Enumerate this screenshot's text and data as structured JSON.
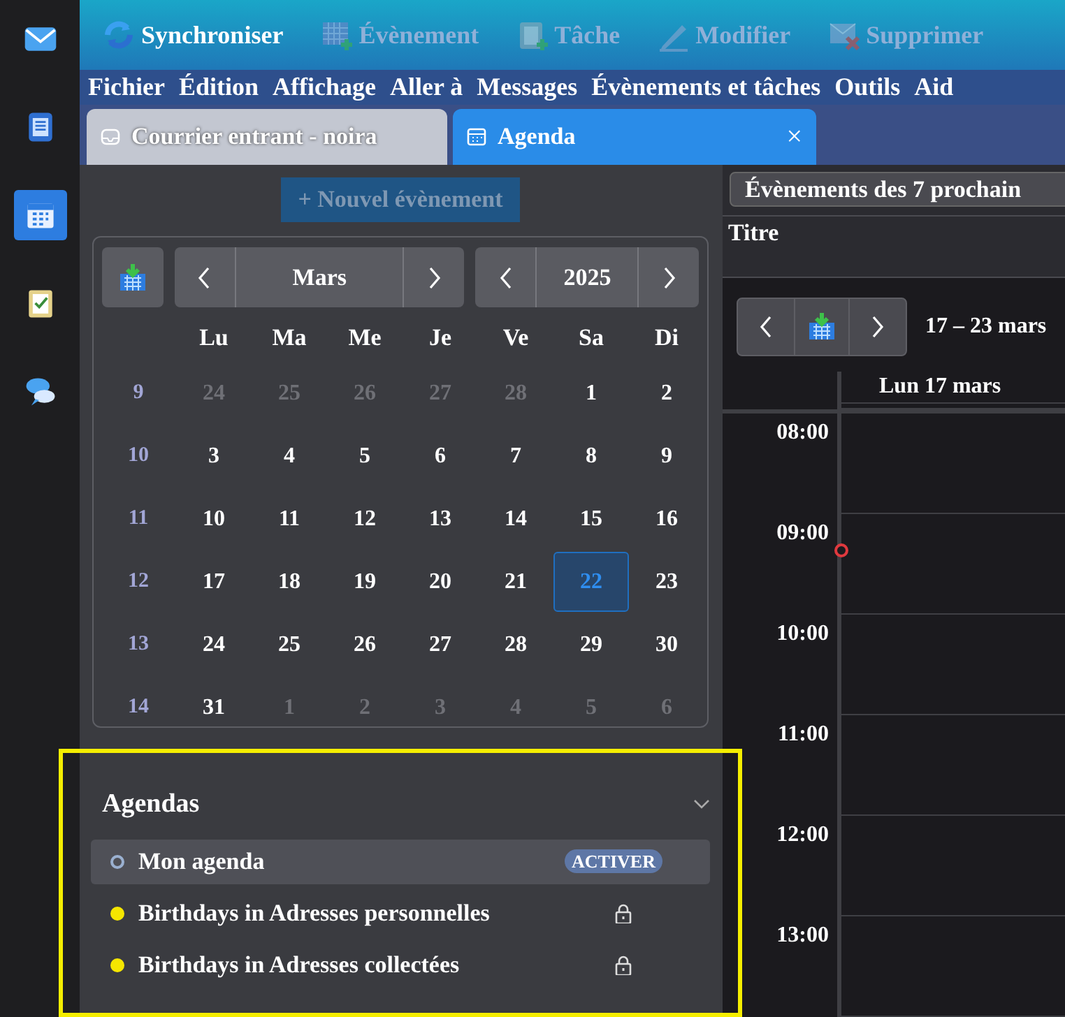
{
  "spaces": [
    {
      "selected": false
    },
    {
      "selected": false
    },
    {
      "selected": true
    },
    {
      "selected": false
    },
    {
      "selected": false
    }
  ],
  "toolbar": [
    {
      "label": "Synchroniser",
      "disabled": false
    },
    {
      "label": "Évènement",
      "disabled": true
    },
    {
      "label": "Tâche",
      "disabled": true
    },
    {
      "label": "Modifier",
      "disabled": true
    },
    {
      "label": "Supprimer",
      "disabled": true
    }
  ],
  "menu": [
    {
      "label": "Fichier"
    },
    {
      "label": "Édition"
    },
    {
      "label": "Affichage"
    },
    {
      "label": "Aller à"
    },
    {
      "label": "Messages"
    },
    {
      "label": "Évènements et tâches"
    },
    {
      "label": "Outils"
    },
    {
      "label": "Aid"
    }
  ],
  "tabs": [
    {
      "label": "Courrier entrant - noira",
      "selected": false
    },
    {
      "label": "Agenda",
      "selected": true,
      "close": "×"
    }
  ],
  "new_event_button": {
    "label": "+ Nouvel évènement",
    "disabled": true
  },
  "minimonth": {
    "month": "Mars",
    "year": "2025",
    "weekdays": [
      "Lu",
      "Ma",
      "Me",
      "Je",
      "Ve",
      "Sa",
      "Di"
    ],
    "weeks": [
      {
        "number": "9",
        "days": [
          {
            "day": "24",
            "in_month": false,
            "selected": false
          },
          {
            "day": "25",
            "in_month": false,
            "selected": false
          },
          {
            "day": "26",
            "in_month": false,
            "selected": false
          },
          {
            "day": "27",
            "in_month": false,
            "selected": false
          },
          {
            "day": "28",
            "in_month": false,
            "selected": false
          },
          {
            "day": "1",
            "in_month": true,
            "selected": false
          },
          {
            "day": "2",
            "in_month": true,
            "selected": false
          }
        ]
      },
      {
        "number": "10",
        "days": [
          {
            "day": "3",
            "in_month": true,
            "selected": false
          },
          {
            "day": "4",
            "in_month": true,
            "selected": false
          },
          {
            "day": "5",
            "in_month": true,
            "selected": false
          },
          {
            "day": "6",
            "in_month": true,
            "selected": false
          },
          {
            "day": "7",
            "in_month": true,
            "selected": false
          },
          {
            "day": "8",
            "in_month": true,
            "selected": false
          },
          {
            "day": "9",
            "in_month": true,
            "selected": false
          }
        ]
      },
      {
        "number": "11",
        "days": [
          {
            "day": "10",
            "in_month": true,
            "selected": false
          },
          {
            "day": "11",
            "in_month": true,
            "selected": false
          },
          {
            "day": "12",
            "in_month": true,
            "selected": false
          },
          {
            "day": "13",
            "in_month": true,
            "selected": false
          },
          {
            "day": "14",
            "in_month": true,
            "selected": false
          },
          {
            "day": "15",
            "in_month": true,
            "selected": false
          },
          {
            "day": "16",
            "in_month": true,
            "selected": false
          }
        ]
      },
      {
        "number": "12",
        "days": [
          {
            "day": "17",
            "in_month": true,
            "selected": false
          },
          {
            "day": "18",
            "in_month": true,
            "selected": false
          },
          {
            "day": "19",
            "in_month": true,
            "selected": false
          },
          {
            "day": "20",
            "in_month": true,
            "selected": false
          },
          {
            "day": "21",
            "in_month": true,
            "selected": false
          },
          {
            "day": "22",
            "in_month": true,
            "selected": true
          },
          {
            "day": "23",
            "in_month": true,
            "selected": false
          }
        ]
      },
      {
        "number": "13",
        "days": [
          {
            "day": "24",
            "in_month": true,
            "selected": false
          },
          {
            "day": "25",
            "in_month": true,
            "selected": false
          },
          {
            "day": "26",
            "in_month": true,
            "selected": false
          },
          {
            "day": "27",
            "in_month": true,
            "selected": false
          },
          {
            "day": "28",
            "in_month": true,
            "selected": false
          },
          {
            "day": "29",
            "in_month": true,
            "selected": false
          },
          {
            "day": "30",
            "in_month": true,
            "selected": false
          }
        ]
      },
      {
        "number": "14",
        "days": [
          {
            "day": "31",
            "in_month": true,
            "selected": false
          },
          {
            "day": "1",
            "in_month": false,
            "selected": false
          },
          {
            "day": "2",
            "in_month": false,
            "selected": false
          },
          {
            "day": "3",
            "in_month": false,
            "selected": false
          },
          {
            "day": "4",
            "in_month": false,
            "selected": false
          },
          {
            "day": "5",
            "in_month": false,
            "selected": false
          },
          {
            "day": "6",
            "in_month": false,
            "selected": false
          }
        ]
      }
    ]
  },
  "calendars": {
    "title": "Agendas",
    "expanded": true,
    "items": [
      {
        "name": "Mon agenda",
        "color": "#9ab0d0",
        "enabled": false,
        "selected": true,
        "locked": false,
        "badge": "ACTIVER"
      },
      {
        "name": "Birthdays in Adresses personnelles",
        "color": "#f5e600",
        "enabled": true,
        "selected": false,
        "locked": true
      },
      {
        "name": "Birthdays in Adresses collectées",
        "color": "#f5e600",
        "enabled": true,
        "selected": false,
        "locked": true
      }
    ]
  },
  "agenda": {
    "filter": "Évènements des 7 prochain",
    "column": "Titre"
  },
  "week_view": {
    "range": "17 – 23 mars",
    "day_header": "Lun 17 mars",
    "hours": [
      "08:00",
      "09:00",
      "10:00",
      "11:00",
      "12:00",
      "13:00"
    ]
  }
}
